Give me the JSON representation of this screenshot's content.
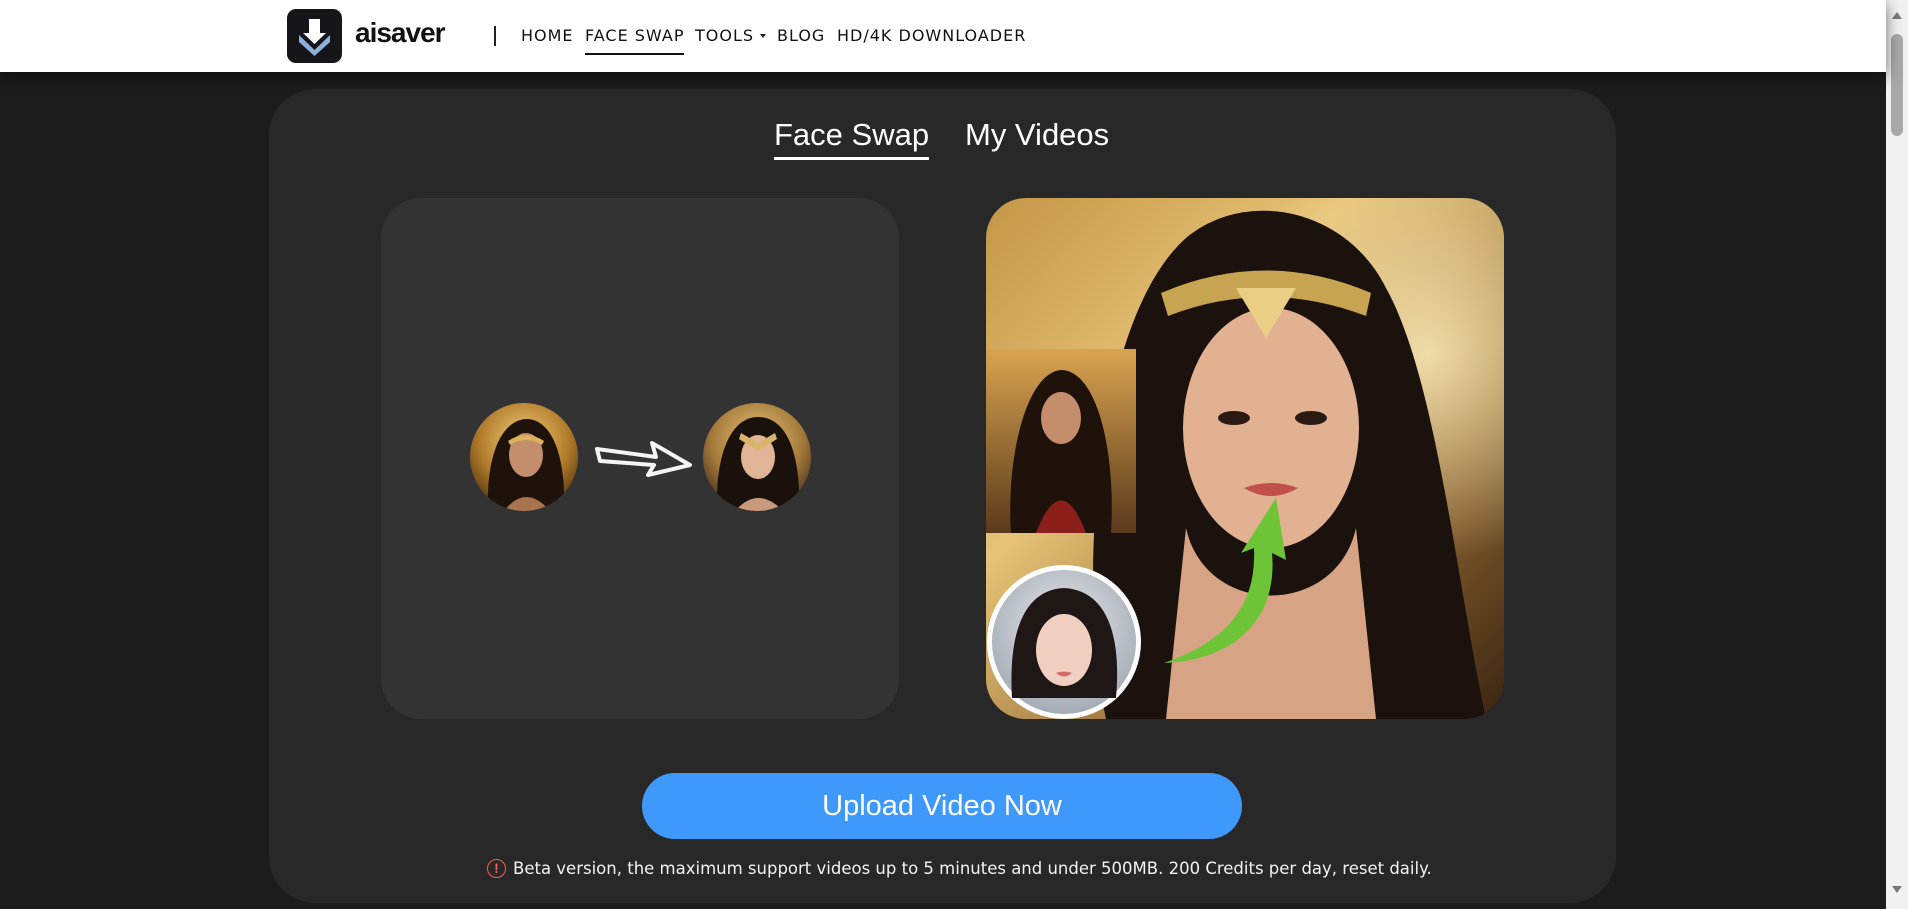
{
  "header": {
    "brand": "aisaver",
    "nav": [
      {
        "label": "HOME"
      },
      {
        "label": "FACE SWAP"
      },
      {
        "label": "TOOLS"
      },
      {
        "label": "BLOG"
      },
      {
        "label": "HD/4K DOWNLOADER"
      }
    ]
  },
  "tabs": [
    {
      "label": "Face Swap"
    },
    {
      "label": "My Videos"
    }
  ],
  "upload": {
    "button_label": "Upload Video Now"
  },
  "notice": {
    "text": "Beta version, the maximum support videos up to 5 minutes and under 500MB. 200 Credits per day, reset daily."
  },
  "colors": {
    "accent": "#3f99fb",
    "panel": "#282828",
    "background": "#1c1c1c",
    "alert": "#ff5a5a",
    "green_arrow": "#6cc436"
  },
  "icons": [
    "download-logo-icon",
    "chevron-down-icon",
    "arrow-right-icon",
    "alert-circle-icon"
  ]
}
